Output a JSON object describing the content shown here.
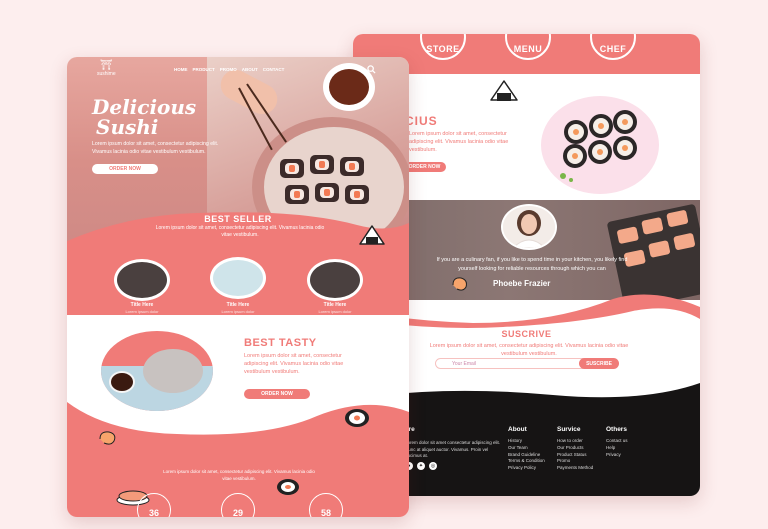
{
  "back_page": {
    "nav_circles": [
      "STORE",
      "MENU",
      "CHEF"
    ],
    "hero_title": "CIUS",
    "hero_text": "Lorem ipsum dolor sit amet, consectetur adipiscing elit. Vivamus lacinia odio vitae vestibulum.",
    "hero_button": "ORDER NOW",
    "testimonial": "If you are a culinary fan, if you like to spend time in your kitchen, you likely find yourself looking for reliable resources through which you can",
    "testimonial_name": "Phoebe Frazier",
    "subscribe_title": "SUSCRIVE",
    "subscribe_text": "Lorem ipsum dolor sit amet, consectetur adipiscing elit. Vivamus lacinia odio vitae vestibulum vestibulum.",
    "email_placeholder": "Your Email",
    "subscribe_button": "SUSCRIBE",
    "footer": {
      "brand_head": "ere",
      "brand_text": "Lorem dolor sit amet consectetur adipiscing elit. Nunc at aliquet auctor. Vivamus. Proin vel ducimus at.",
      "about_head": "About",
      "about_items": [
        "History",
        "Our Team",
        "Brand Guideline",
        "Terms & Condition",
        "Privacy Policy"
      ],
      "service_head": "Survice",
      "service_items": [
        "How to order",
        "Our Products",
        "Product Status",
        "Promo",
        "Payments Method"
      ],
      "others_head": "Others",
      "others_items": [
        "Contact us",
        "Help",
        "Privacy"
      ]
    }
  },
  "front_page": {
    "logo_text": "sushime",
    "nav": [
      "HOME",
      "PRODUCT",
      "PROMO",
      "ABOUT",
      "CONTACT"
    ],
    "headline_1": "Delicious",
    "headline_2": "Sushi",
    "hero_text": "Lorem ipsum dolor sit amet, consectetur adipiscing elit. Vivamus lacinia odio vitae vestibulum vestibulum.",
    "order_button": "ORDER NOW",
    "best_seller_title": "BEST SELLER",
    "best_seller_text": "Lorem ipsum dolor sit amet, consectetur adipiscing elit. Vivamus lacinia odio vitae vestibulum.",
    "dishes": [
      {
        "title": "Title Here",
        "subtitle": "Lorem ipsum dolor"
      },
      {
        "title": "Title Here",
        "subtitle": "Lorem ipsum dolor"
      },
      {
        "title": "Title Here",
        "subtitle": "Lorem ipsum dolor"
      }
    ],
    "best_tasty_title": "BEST TASTY",
    "best_tasty_text": "Lorem ipsum dolor sit amet, consectetur adipiscing elit. Vivamus lacinia odio vitae vestibulum vestibulum.",
    "best_tasty_button": "ORDER NOW",
    "bottom_text": "Lorem ipsum dolor sit amet, consectetur adipiscing elit. Vivamus lacinia odio vitae vestibulum.",
    "stats": [
      "36",
      "29",
      "58"
    ]
  },
  "colors": {
    "accent": "#f07b78",
    "background": "#fdeeee",
    "footer": "#161414"
  }
}
